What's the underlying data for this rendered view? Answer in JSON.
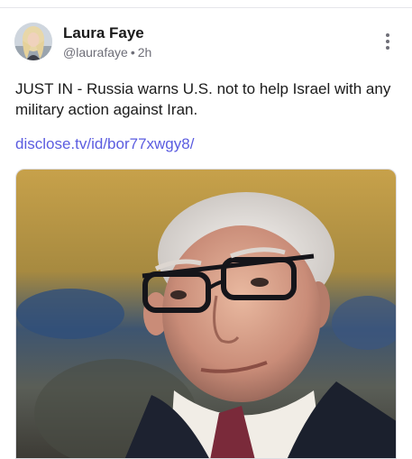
{
  "author": {
    "name": "Laura Faye",
    "handle": "@laurafaye",
    "separator": "•",
    "time": "2h"
  },
  "post": {
    "text": "JUST IN - Russia warns U.S. not to help Israel with any military action against Iran.",
    "link": "disclose.tv/id/bor77xwgy8/"
  },
  "icons": {
    "menu": "more-vertical-icon"
  },
  "colors": {
    "link": "#5b5ce0",
    "meta": "#6e6e78"
  }
}
